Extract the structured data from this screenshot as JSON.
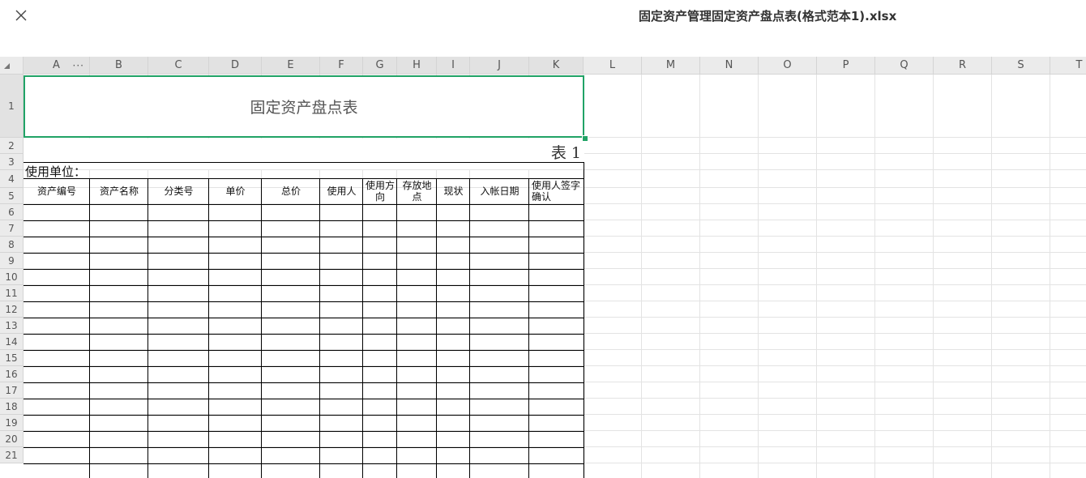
{
  "window": {
    "filename": "固定资产管理固定资产盘点表(格式范本1).xlsx"
  },
  "columns": [
    "A",
    "B",
    "C",
    "D",
    "E",
    "F",
    "G",
    "H",
    "I",
    "J",
    "K",
    "L",
    "M",
    "N",
    "O",
    "P",
    "Q",
    "R",
    "S",
    "T"
  ],
  "rows": [
    "1",
    "2",
    "3",
    "4",
    "5",
    "6",
    "7",
    "8",
    "9",
    "10",
    "11",
    "12",
    "13",
    "14",
    "15",
    "16",
    "17",
    "18",
    "19",
    "20",
    "21"
  ],
  "cells": {
    "title": "固定资产盘点表",
    "table_number": "表 1",
    "unit_label": "使用单位：",
    "headers": [
      "资产编号",
      "资产名称",
      "分类号",
      "单价",
      "总价",
      "使用人",
      "使用方向",
      "存放地点",
      "现状",
      "入帐日期",
      "使用人签字确认"
    ]
  },
  "icons": {
    "close": "close-icon",
    "corner": "select-all-icon",
    "more": "more-icon"
  },
  "colors": {
    "selection": "#21a366",
    "header_bg": "#ebebeb",
    "grid": "#e3e3e3"
  }
}
